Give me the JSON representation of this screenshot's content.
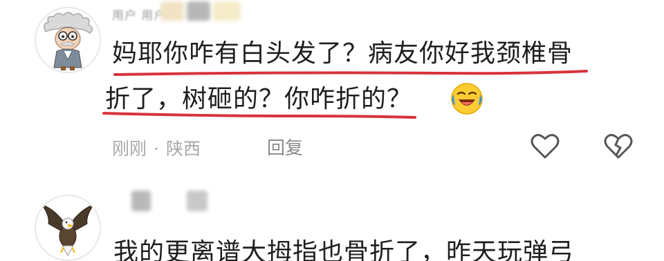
{
  "comments": [
    {
      "username": "用户 用户",
      "text_line1": "妈耶你咋有白头发了？病友你好我颈椎骨",
      "text_line2": "折了，树砸的？你咋折的？",
      "emoji": "laughing-crying-emoji",
      "time": "刚刚",
      "separator": "·",
      "location": "陕西",
      "reply_label": "回复",
      "like_icon": "heart-outline-icon",
      "dislike_icon": "broken-heart-icon",
      "avatar": "cartoon-professor-avatar"
    },
    {
      "text_line1": "我的更离谱大拇指也骨折了，昨天玩弹弓",
      "avatar": "eagle-avatar"
    }
  ],
  "colors": {
    "underline": "#d8323c",
    "meta_text": "#a8a8a8",
    "body_text": "#1e1e1e"
  }
}
